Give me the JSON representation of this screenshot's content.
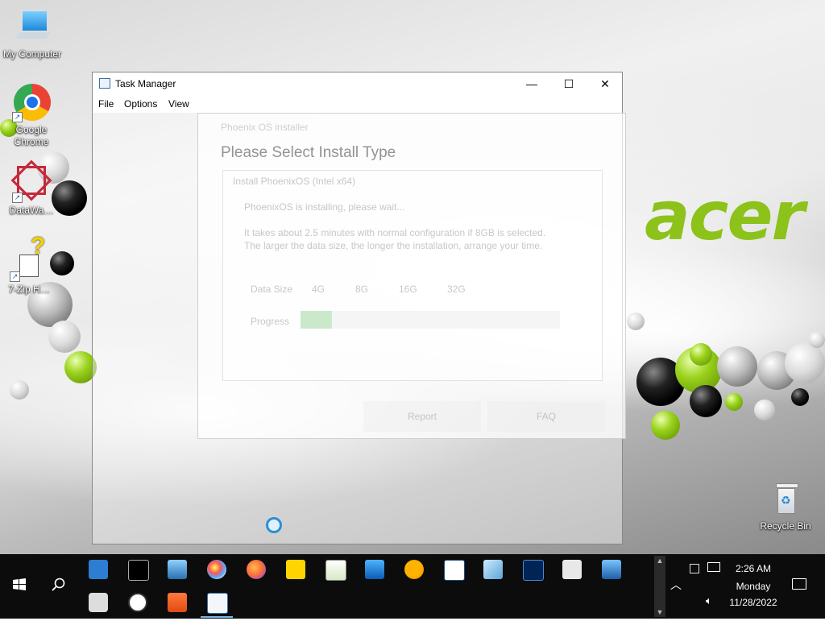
{
  "desktop": {
    "brand": "acer",
    "icons": [
      {
        "label": "My Computer"
      },
      {
        "label": "Google Chrome"
      },
      {
        "label": "DataWa…"
      },
      {
        "label": "7-Zip H…"
      },
      {
        "label": "Recycle Bin"
      }
    ]
  },
  "task_manager": {
    "title": "Task Manager",
    "menu": [
      "File",
      "Options",
      "View"
    ],
    "controls": {
      "minimize": "—",
      "maximize": "☐",
      "close": "✕"
    }
  },
  "installer": {
    "title": "Phoenix OS installer",
    "heading": "Please Select Install Type",
    "subtitle": "Install PhoenixOS (Intel x64)",
    "status": "PhoenixOS is installing, please wait...",
    "note_line1": "It takes about 2.5 minutes with normal configuration if 8GB is selected.",
    "note_line2": "The larger the data size, the longer the installation, arrange your time.",
    "data_size_label": "Data Size",
    "data_size_options": [
      "4G",
      "8G",
      "16G",
      "32G"
    ],
    "progress_label": "Progress",
    "progress_fraction": 0.12,
    "buttons": {
      "report": "Report",
      "faq": "FAQ"
    }
  },
  "taskbar": {
    "apps_row1": [
      {
        "name": "control-panel"
      },
      {
        "name": "command-prompt"
      },
      {
        "name": "remote-desktop"
      },
      {
        "name": "paint"
      },
      {
        "name": "firefox"
      },
      {
        "name": "sticky-notes"
      },
      {
        "name": "notepad-plus"
      },
      {
        "name": "photos"
      },
      {
        "name": "weather"
      },
      {
        "name": "solitaire"
      },
      {
        "name": "mirror-app"
      },
      {
        "name": "powershell"
      },
      {
        "name": "character-map"
      },
      {
        "name": "remote-assist"
      }
    ],
    "apps_row2": [
      {
        "name": "camera"
      },
      {
        "name": "clock"
      },
      {
        "name": "installer-app"
      },
      {
        "name": "task-manager",
        "active": true
      }
    ],
    "clock": {
      "time": "2:26 AM",
      "day": "Monday",
      "date": "11/28/2022"
    }
  }
}
